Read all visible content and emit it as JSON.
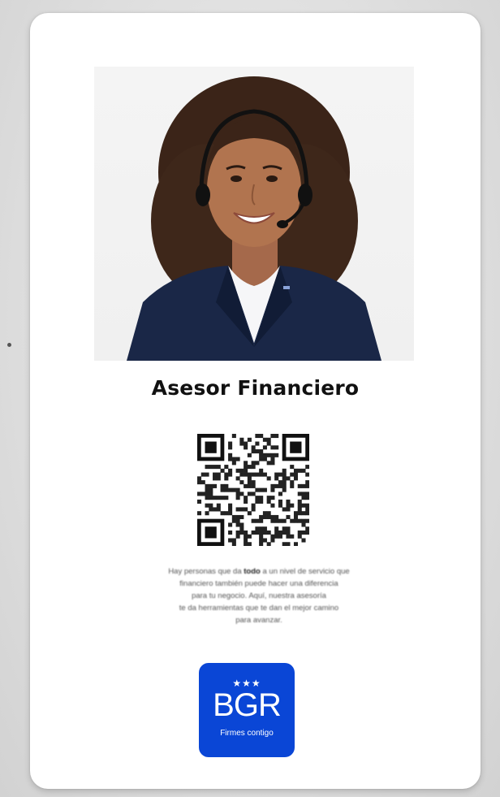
{
  "card": {
    "title": "Asesor Financiero",
    "description_html_note": "",
    "description": {
      "line1_pre": "Hay personas que da ",
      "line1_bold": "todo",
      "line1_post": " a un nivel de servicio que",
      "line2": "financiero también puede hacer una diferencia",
      "line3": "para tu negocio. Aquí, nuestra asesoría",
      "line4": "te da herramientas que te dan el mejor camino",
      "line5": "para avanzar."
    },
    "logo": {
      "stars": "★★★",
      "brand": "BGR",
      "tagline": "Firmes contigo"
    }
  },
  "colors": {
    "logo_bg": "#0a46d6",
    "card_bg": "#ffffff",
    "jacket": "#1a2747"
  },
  "icons": {
    "qr": "qr-code-icon",
    "photo": "advisor-photo"
  }
}
